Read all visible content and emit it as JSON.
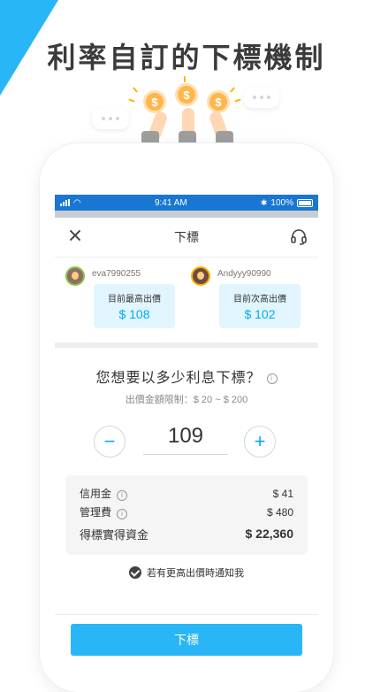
{
  "headline": "利率自訂的下標機制",
  "status_bar": {
    "time": "9:41 AM",
    "battery": "100%"
  },
  "header": {
    "title": "下標"
  },
  "bidders": [
    {
      "username": "eva7990255",
      "label": "目前最高出價",
      "amount": "$ 108"
    },
    {
      "username": "Andyyy90990",
      "label": "目前次高出價",
      "amount": "$ 102"
    }
  ],
  "bid": {
    "question": "您想要以多少利息下標？",
    "limit": "出價金額限制：$ 20 ~ $ 200",
    "value": "109",
    "minus": "−",
    "plus": "+"
  },
  "fees": [
    {
      "label": "信用金",
      "value": "$ 41"
    },
    {
      "label": "管理費",
      "value": "$ 480"
    }
  ],
  "total": {
    "label": "得標實得資金",
    "value": "$ 22,360"
  },
  "notify": {
    "label": "若有更高出價時通知我"
  },
  "submit": {
    "label": "下標"
  },
  "colors": {
    "accent": "#29b6f6",
    "bid_amount": "#03a9f4",
    "status_bar": "#1976d2"
  }
}
